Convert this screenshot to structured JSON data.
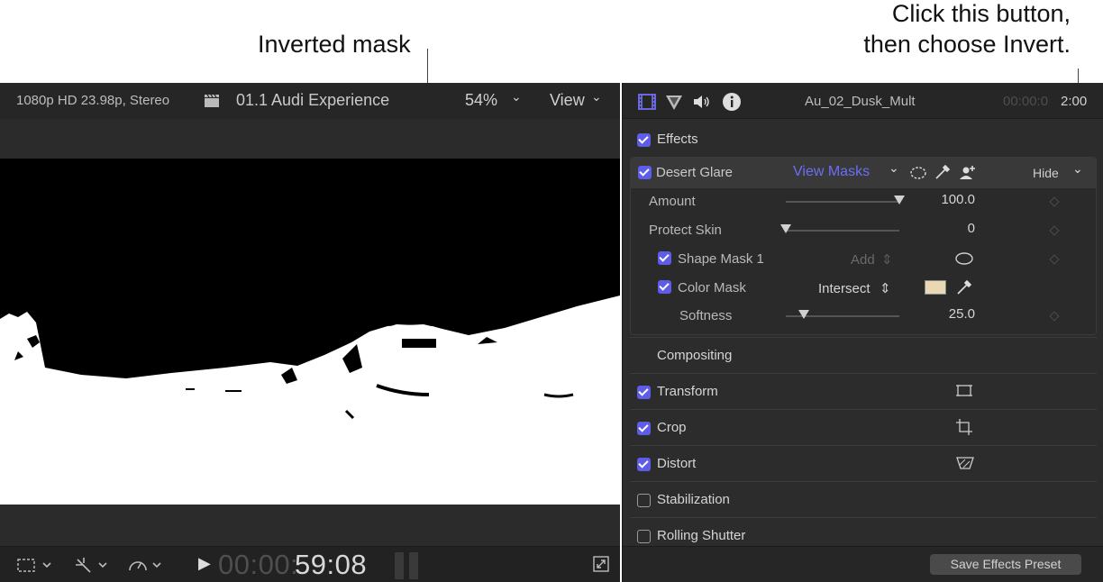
{
  "callouts": {
    "left": "Inverted mask",
    "right_line1": "Click this button,",
    "right_line2": "then choose Invert."
  },
  "viewer": {
    "format": "1080p HD 23.98p, Stereo",
    "title": "01.1 Audi Experience",
    "zoom": "54%",
    "view_label": "View",
    "timecode_dim": "00:00:",
    "timecode": "59:08"
  },
  "inspector": {
    "clip_name": "Au_02_Dusk_Mult",
    "timecode_dim": "00:00:0",
    "timecode": "2:00",
    "effects_label": "Effects",
    "effect": {
      "name": "Desert Glare",
      "view_masks": "View Masks",
      "hide": "Hide",
      "params": {
        "amount_label": "Amount",
        "amount_value": "100.0",
        "amount_level": 1.0,
        "protect_label": "Protect Skin",
        "protect_value": "0",
        "protect_level": 0.0,
        "shape_mask_label": "Shape Mask 1",
        "shape_mask_add": "Add",
        "color_mask_label": "Color Mask",
        "color_mask_mode": "Intersect",
        "softness_label": "Softness",
        "softness_value": "25.0",
        "softness_level": 0.16
      }
    },
    "sections": [
      {
        "label": "Compositing",
        "checkbox": "none"
      },
      {
        "label": "Transform",
        "checkbox": "on"
      },
      {
        "label": "Crop",
        "checkbox": "on"
      },
      {
        "label": "Distort",
        "checkbox": "on"
      },
      {
        "label": "Stabilization",
        "checkbox": "off"
      },
      {
        "label": "Rolling Shutter",
        "checkbox": "off"
      }
    ],
    "save_preset": "Save Effects Preset"
  },
  "colors": {
    "accent": "#5d5dea",
    "link": "#6e6ef5",
    "panel_bg": "#2c2c2c"
  }
}
